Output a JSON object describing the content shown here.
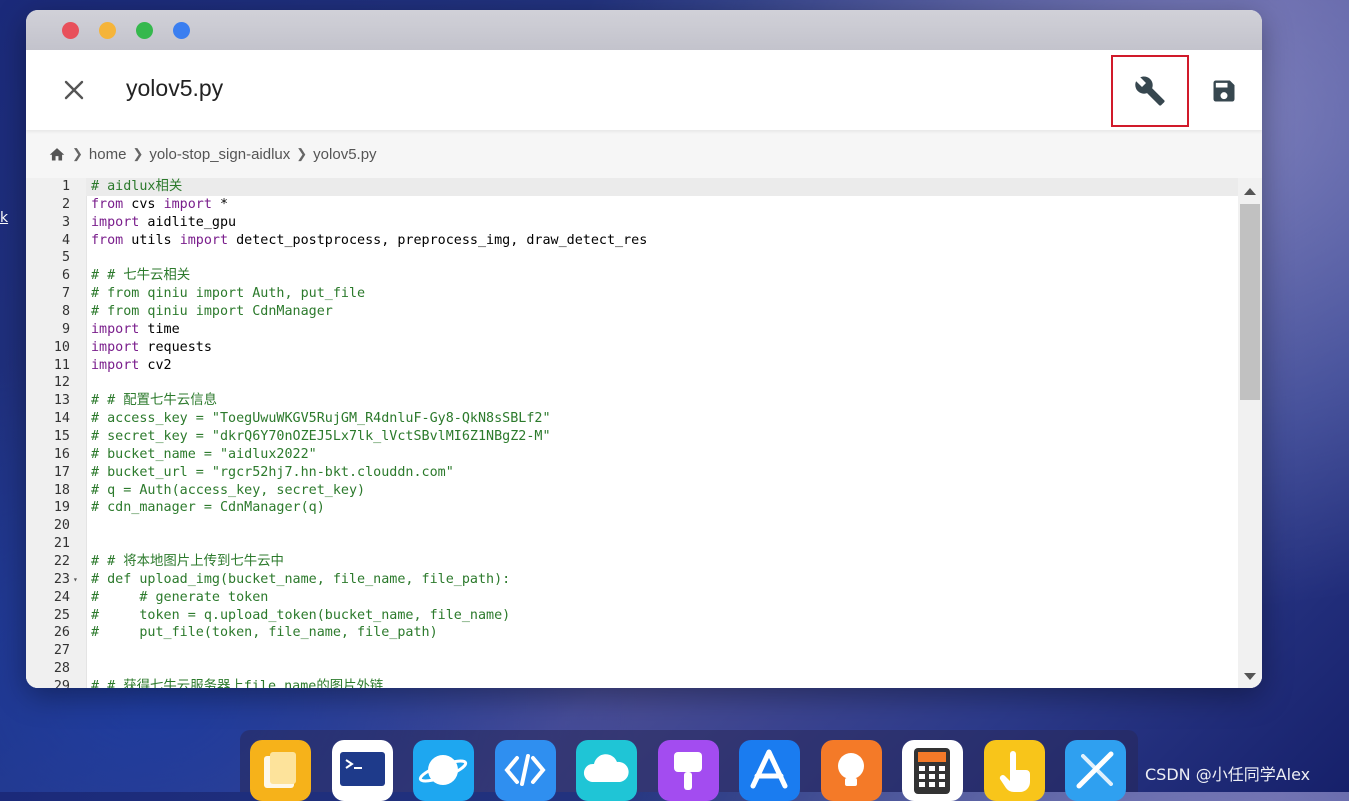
{
  "desktop": {
    "edge_glyph": "k"
  },
  "window": {
    "traffic_lights": [
      "#e8505b",
      "#f5b43a",
      "#35b84d",
      "#3a7ef0"
    ],
    "title": "yolov5.py",
    "breadcrumb": [
      "home",
      "yolo-stop_sign-aidlux",
      "yolov5.py"
    ],
    "accent_border": "#d11a2a"
  },
  "editor": {
    "active_line": 1,
    "lines": [
      {
        "n": "1",
        "t": "# aidlux相关",
        "c": "cm"
      },
      {
        "n": "2",
        "parts": [
          [
            "from",
            "kw"
          ],
          [
            " cvs ",
            ""
          ],
          [
            "import",
            "kw"
          ],
          [
            " *",
            ""
          ]
        ]
      },
      {
        "n": "3",
        "parts": [
          [
            "import",
            "kw"
          ],
          [
            " aidlite_gpu",
            ""
          ]
        ]
      },
      {
        "n": "4",
        "parts": [
          [
            "from",
            "kw"
          ],
          [
            " utils ",
            ""
          ],
          [
            "import",
            "kw"
          ],
          [
            " detect_postprocess, preprocess_img, draw_detect_res",
            ""
          ]
        ]
      },
      {
        "n": "5",
        "t": ""
      },
      {
        "n": "6",
        "t": "# # 七牛云相关",
        "c": "cm"
      },
      {
        "n": "7",
        "t": "# from qiniu import Auth, put_file",
        "c": "cm"
      },
      {
        "n": "8",
        "t": "# from qiniu import CdnManager",
        "c": "cm"
      },
      {
        "n": "9",
        "parts": [
          [
            "import",
            "kw"
          ],
          [
            " time",
            ""
          ]
        ]
      },
      {
        "n": "10",
        "parts": [
          [
            "import",
            "kw"
          ],
          [
            " requests",
            ""
          ]
        ]
      },
      {
        "n": "11",
        "parts": [
          [
            "import",
            "kw"
          ],
          [
            " cv2",
            ""
          ]
        ]
      },
      {
        "n": "12",
        "t": ""
      },
      {
        "n": "13",
        "t": "# # 配置七牛云信息",
        "c": "cm"
      },
      {
        "n": "14",
        "t": "# access_key = \"ToegUwuWKGV5RujGM_R4dnluF-Gy8-QkN8sSBLf2\"",
        "c": "cm"
      },
      {
        "n": "15",
        "t": "# secret_key = \"dkrQ6Y70nOZEJ5Lx7lk_lVctSBvlMI6Z1NBgZ2-M\"",
        "c": "cm"
      },
      {
        "n": "16",
        "t": "# bucket_name = \"aidlux2022\"",
        "c": "cm"
      },
      {
        "n": "17",
        "t": "# bucket_url = \"rgcr52hj7.hn-bkt.clouddn.com\"",
        "c": "cm"
      },
      {
        "n": "18",
        "t": "# q = Auth(access_key, secret_key)",
        "c": "cm"
      },
      {
        "n": "19",
        "t": "# cdn_manager = CdnManager(q)",
        "c": "cm"
      },
      {
        "n": "20",
        "t": ""
      },
      {
        "n": "21",
        "t": ""
      },
      {
        "n": "22",
        "t": "# # 将本地图片上传到七牛云中",
        "c": "cm"
      },
      {
        "n": "23",
        "t": "# def upload_img(bucket_name, file_name, file_path):",
        "c": "cm",
        "fold": "▾"
      },
      {
        "n": "24",
        "t": "#     # generate token",
        "c": "cm"
      },
      {
        "n": "25",
        "t": "#     token = q.upload_token(bucket_name, file_name)",
        "c": "cm"
      },
      {
        "n": "26",
        "t": "#     put_file(token, file_name, file_path)",
        "c": "cm"
      },
      {
        "n": "27",
        "t": ""
      },
      {
        "n": "28",
        "t": ""
      },
      {
        "n": "29",
        "t": "# # 获得七牛云服务器上file_name的图片外链",
        "c": "cm"
      }
    ],
    "scroll_position": 0
  },
  "dock": {
    "apps": [
      {
        "name": "files",
        "icon": "folder-icon",
        "color": "#f6b21a"
      },
      {
        "name": "terminal",
        "icon": "terminal-icon",
        "color": "#ffffff"
      },
      {
        "name": "browser",
        "icon": "planet-icon",
        "color": "#1ea7f0"
      },
      {
        "name": "code",
        "icon": "code-icon",
        "color": "#2f8ff0"
      },
      {
        "name": "cloud",
        "icon": "cloud-icon",
        "color": "#1fc5d6"
      },
      {
        "name": "paint",
        "icon": "brush-icon",
        "color": "#a34cf0"
      },
      {
        "name": "appstore",
        "icon": "appstore-icon",
        "color": "#1a7cf0"
      },
      {
        "name": "tips",
        "icon": "bulb-icon",
        "color": "#f47a28"
      },
      {
        "name": "calculator",
        "icon": "calculator-icon",
        "color": "#ffffff"
      },
      {
        "name": "touch",
        "icon": "hand-icon",
        "color": "#f8c51a"
      },
      {
        "name": "tools",
        "icon": "tools-icon",
        "color": "#2fa0f0"
      }
    ]
  },
  "watermark": "CSDN @小任同学Alex"
}
